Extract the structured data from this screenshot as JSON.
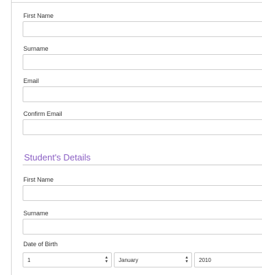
{
  "parent_form": {
    "first_name_label": "First Name",
    "surname_label": "Surname",
    "email_label": "Email",
    "confirm_email_label": "Confirm Email"
  },
  "student_section": {
    "title": "Student's Details",
    "first_name_label": "First Name",
    "surname_label": "Surname",
    "dob_label": "Date of Birth",
    "dob_day": "1",
    "dob_month": "January",
    "dob_year": "2010"
  },
  "icons": {
    "select_arrow": "updown-chevron-icon"
  },
  "colors": {
    "section_title": "#8b5fc4"
  }
}
